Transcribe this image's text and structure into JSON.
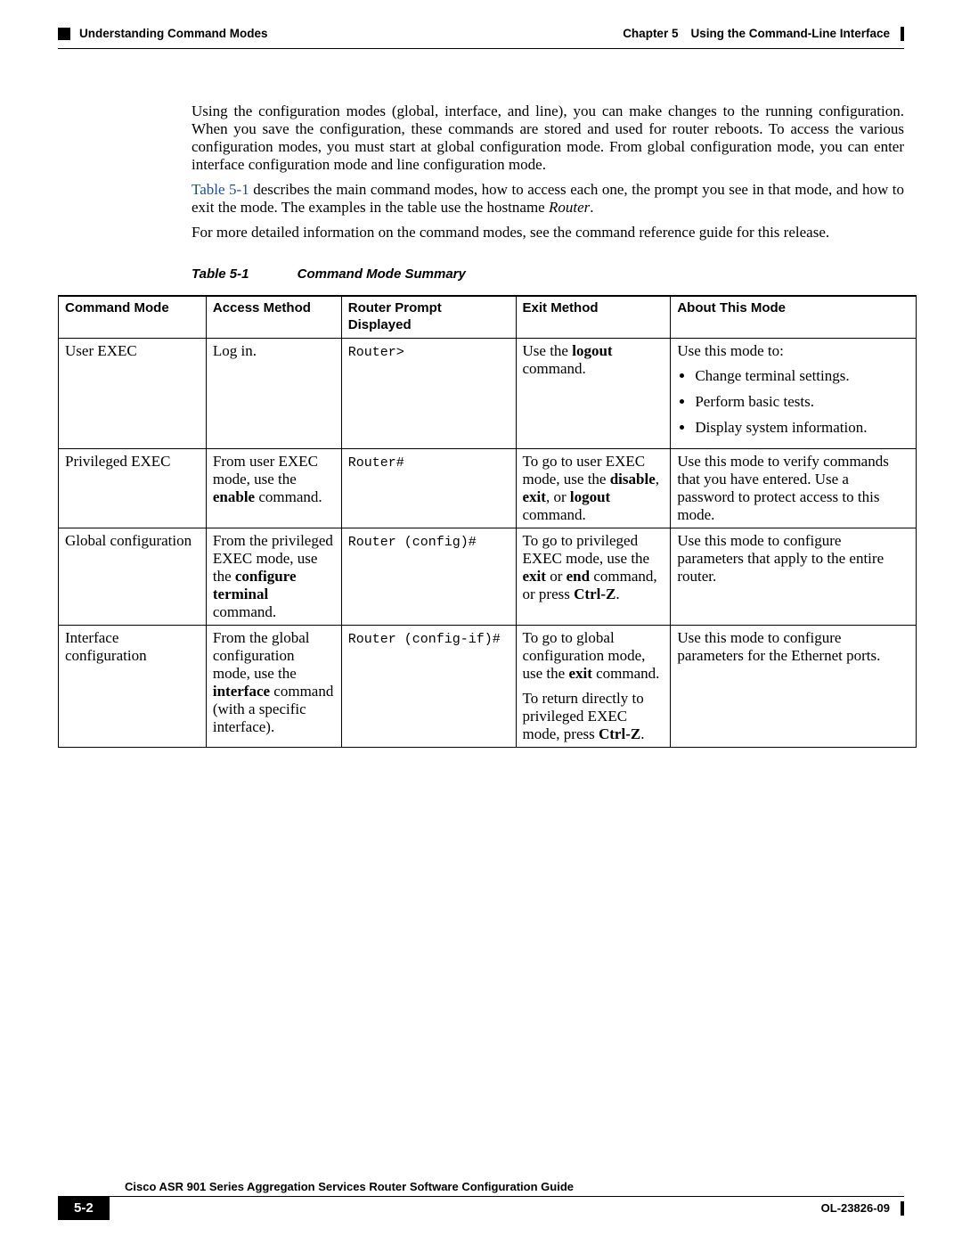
{
  "header": {
    "section": "Understanding Command Modes",
    "chapter_label": "Chapter 5",
    "chapter_title": "Using the Command-Line Interface"
  },
  "body": {
    "para1": "Using the configuration modes (global, interface, and line), you can make changes to the running configuration. When you save the configuration, these commands are stored and used for router reboots. To access the various configuration modes, you must start at global configuration mode. From global configuration mode, you can enter interface configuration mode and line configuration mode.",
    "para2_link": "Table 5-1",
    "para2_rest": " describes the main command modes, how to access each one, the prompt you see in that mode, and how to exit the mode. The examples in the table use the hostname ",
    "para2_italic": "Router",
    "para2_end": ".",
    "para3": "For more detailed information on the command modes, see the command reference guide for this release."
  },
  "table": {
    "label": "Table 5-1",
    "caption": "Command Mode Summary",
    "headers": {
      "c1": "Command Mode",
      "c2": "Access Method",
      "c3_a": "Router Prompt",
      "c3_b": "Displayed",
      "c4": "Exit Method",
      "c5": "About This Mode"
    },
    "rows": [
      {
        "mode": "User EXEC",
        "access": "Log in.",
        "prompt": "Router>",
        "exit_pre": "Use the ",
        "exit_b1": "logout",
        "exit_post": " command.",
        "about_intro": "Use this mode to:",
        "about_items": [
          "Change terminal settings.",
          "Perform basic tests.",
          "Display system information."
        ]
      },
      {
        "mode": "Privileged EXEC",
        "access_pre": "From user EXEC mode, use the ",
        "access_b": "enable",
        "access_post": " command.",
        "prompt": "Router#",
        "exit_pre": "To go to user EXEC mode, use the ",
        "exit_b1": "disable",
        "exit_mid": ", ",
        "exit_b2": "exit",
        "exit_mid2": ", or ",
        "exit_b3": "logout",
        "exit_post": " command.",
        "about": "Use this mode to verify commands that you have entered. Use a password to protect access to this mode."
      },
      {
        "mode": "Global configuration",
        "access_pre": "From the privileged EXEC mode, use the ",
        "access_b": "configure terminal",
        "access_post": " command.",
        "prompt": "Router (config)#",
        "exit_pre": "To go to privileged EXEC mode, use the ",
        "exit_b1": "exit",
        "exit_mid": " or ",
        "exit_b2": "end",
        "exit_mid2": " command, or press ",
        "exit_b3": "Ctrl-Z",
        "exit_post": ".",
        "about": "Use this mode to configure parameters that apply to the entire router."
      },
      {
        "mode": "Interface configuration",
        "access_pre": "From the global configuration mode, use the ",
        "access_b": "interface",
        "access_post": " command (with a specific interface).",
        "prompt": "Router (config-if)#",
        "exit_p1_pre": "To go to global configuration mode, use the ",
        "exit_p1_b": "exit",
        "exit_p1_post": " command.",
        "exit_p2_pre": "To return directly to privileged EXEC mode, press ",
        "exit_p2_b": "Ctrl-Z",
        "exit_p2_post": ".",
        "about": "Use this mode to configure parameters for the Ethernet ports."
      }
    ]
  },
  "footer": {
    "guide": "Cisco ASR 901 Series Aggregation Services Router Software Configuration Guide",
    "page": "5-2",
    "docid": "OL-23826-09"
  }
}
